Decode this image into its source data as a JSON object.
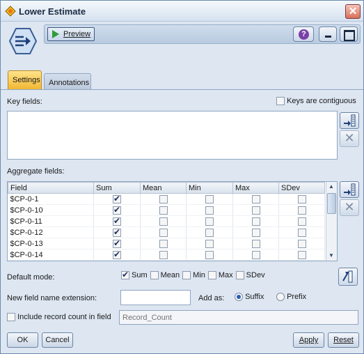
{
  "window": {
    "title": "Lower Estimate",
    "close_glyph": "✕"
  },
  "toolbar": {
    "preview_label": "Preview",
    "help_glyph": "?"
  },
  "tabs": [
    {
      "label": "Settings",
      "active": true
    },
    {
      "label": "Annotations",
      "active": false
    }
  ],
  "key_fields": {
    "label": "Key fields:",
    "contiguous_label": "Keys are contiguous",
    "contiguous_checked": false
  },
  "aggregate": {
    "label": "Aggregate fields:",
    "columns": [
      "Field",
      "Sum",
      "Mean",
      "Min",
      "Max",
      "SDev"
    ],
    "rows": [
      {
        "field": "$CP-0-1",
        "sum": true,
        "mean": false,
        "min": false,
        "max": false,
        "sdev": false
      },
      {
        "field": "$CP-0-10",
        "sum": true,
        "mean": false,
        "min": false,
        "max": false,
        "sdev": false
      },
      {
        "field": "$CP-0-11",
        "sum": true,
        "mean": false,
        "min": false,
        "max": false,
        "sdev": false
      },
      {
        "field": "$CP-0-12",
        "sum": true,
        "mean": false,
        "min": false,
        "max": false,
        "sdev": false
      },
      {
        "field": "$CP-0-13",
        "sum": true,
        "mean": false,
        "min": false,
        "max": false,
        "sdev": false
      },
      {
        "field": "$CP-0-14",
        "sum": true,
        "mean": false,
        "min": false,
        "max": false,
        "sdev": false
      }
    ]
  },
  "default_mode": {
    "label": "Default mode:",
    "options": [
      {
        "label": "Sum",
        "checked": true
      },
      {
        "label": "Mean",
        "checked": false
      },
      {
        "label": "Min",
        "checked": false
      },
      {
        "label": "Max",
        "checked": false
      },
      {
        "label": "SDev",
        "checked": false
      }
    ]
  },
  "extension": {
    "label": "New field name extension:",
    "value": "",
    "add_as_label": "Add as:",
    "suffix_label": "Suffix",
    "prefix_label": "Prefix",
    "selected": "Suffix"
  },
  "record_count": {
    "label": "Include record count in field",
    "checked": false,
    "placeholder": "Record_Count"
  },
  "buttons": {
    "ok": "OK",
    "cancel": "Cancel",
    "apply": "Apply",
    "reset": "Reset"
  },
  "colors": {
    "active_tab": "#f2b733",
    "title_bar": "#d6e2f0",
    "close": "#d9705a"
  }
}
